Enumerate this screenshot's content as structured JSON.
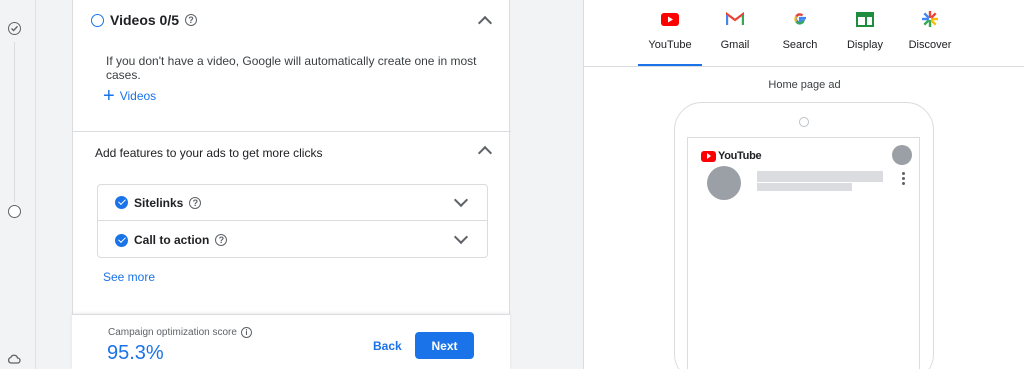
{
  "colors": {
    "accent": "#1a73e8",
    "youtube_red": "#ff0000"
  },
  "videos": {
    "title": "Videos 0/5",
    "info": "If you don't have a video, Google will automatically create one in most cases.",
    "add_label": "Videos"
  },
  "features": {
    "title": "Add features to your ads to get more clicks",
    "items": [
      {
        "label": "Sitelinks"
      },
      {
        "label": "Call to action"
      }
    ],
    "see_more": "See more"
  },
  "footer": {
    "score_label": "Campaign optimization score",
    "score": "95.3%",
    "back": "Back",
    "next": "Next"
  },
  "preview": {
    "tabs": [
      {
        "label": "YouTube",
        "icon": "youtube-icon",
        "active": true
      },
      {
        "label": "Gmail",
        "icon": "gmail-icon"
      },
      {
        "label": "Search",
        "icon": "google-icon"
      },
      {
        "label": "Display",
        "icon": "display-icon"
      },
      {
        "label": "Discover",
        "icon": "discover-icon"
      }
    ],
    "placement_label": "Home page ad",
    "logo_text": "YouTube"
  }
}
